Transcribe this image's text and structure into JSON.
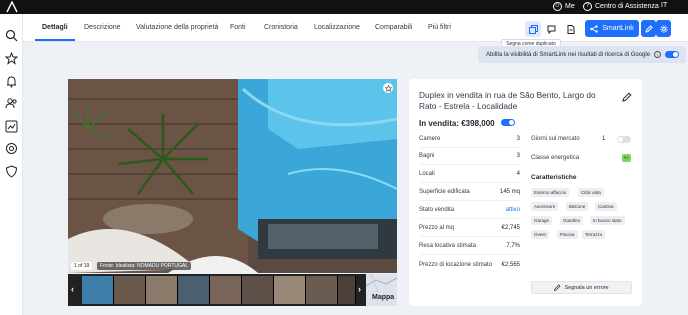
{
  "topbar": {
    "me_label": "Me",
    "help_label": "Centro di Assistenza",
    "language": "IT"
  },
  "tabs": [
    {
      "label": "Dettagli",
      "active": true
    },
    {
      "label": "Descrizione"
    },
    {
      "label": "Valutazione della proprietà"
    },
    {
      "label": "Fonti"
    },
    {
      "label": "Cronistoria"
    },
    {
      "label": "Localizzazione"
    },
    {
      "label": "Comparabili"
    },
    {
      "label": "Più filtri"
    }
  ],
  "toolbar": {
    "smartlink_label": "SmartLink",
    "tooltip": "Segna come duplicato"
  },
  "visibility_banner": {
    "text": "Abilita la visibilità di SmartLink nei risultati di ricerca di Google",
    "enabled": true
  },
  "gallery": {
    "counter": "1 of 19",
    "source": "Fonte: Idealista: NOMADU PORTUGAL",
    "map_label": "Mappa"
  },
  "listing": {
    "title": "Duplex in vendita in rua de São Bento, Largo do Rato - Estrela - Localidade",
    "price_label": "In vendita: €398,000",
    "details": [
      {
        "label": "Camere",
        "value": "3"
      },
      {
        "label": "Bagni",
        "value": "3"
      },
      {
        "label": "Locali",
        "value": "4"
      },
      {
        "label": "Superficie edificata",
        "value": "145 mq"
      },
      {
        "label": "Stato vendita",
        "value": "attivo"
      },
      {
        "label": "Prezzo al mq",
        "value": "€2,745"
      },
      {
        "label": "Resa locativa stimata",
        "value": "7.7%"
      },
      {
        "label": "Prezzo di locazione stimato",
        "value": "€2,565"
      }
    ],
    "days_on_market_label": "Giorni sul mercato",
    "days_on_market_value": "1",
    "energy_label": "Classe energetica",
    "energy_value": "A+",
    "features_title": "Caratteristiche",
    "features": [
      "Esterno affaccio",
      "Città vista",
      "Ascensore",
      "Balcone",
      "Cantina",
      "Garage",
      "Giardino",
      "In buono stato",
      "Ovest",
      "Piscina",
      "Terrazzo"
    ],
    "report_label": "Segnala un errore"
  },
  "colors": {
    "accent": "#1f6fff",
    "energy": "#7ed957"
  }
}
